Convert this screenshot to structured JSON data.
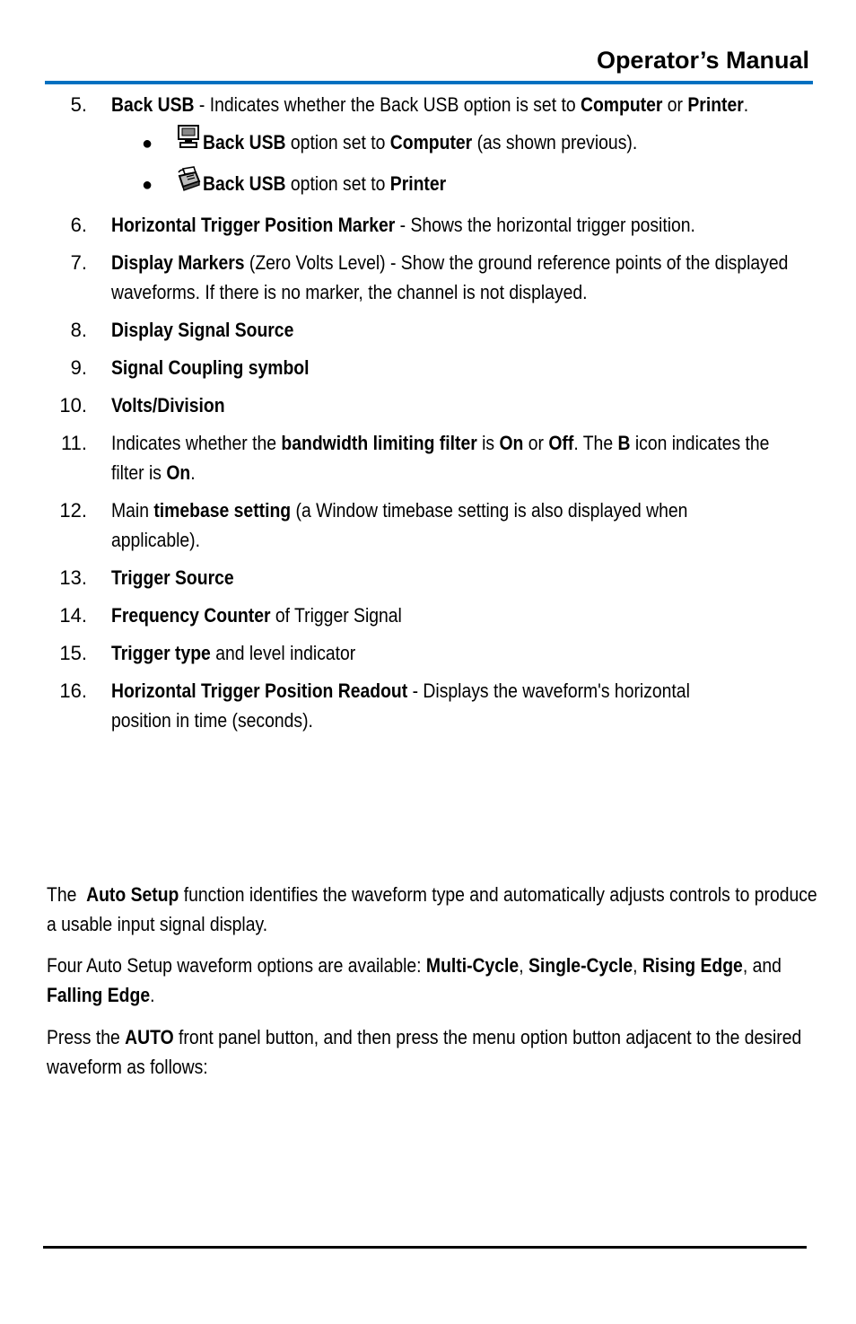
{
  "header": {
    "title": "Operator’s Manual",
    "accent_color": "#0070c0"
  },
  "list": {
    "item5": {
      "num": "5.",
      "b1": "Back USB",
      "t1": " - Indicates whether the Back USB option is set to ",
      "b2": "Computer",
      "t2": " or ",
      "b3": "Printer",
      "t3": ".",
      "bullets": [
        {
          "icon": "computer-icon",
          "b1": "Back USB",
          "t1": " option set to ",
          "b2": "Computer",
          "t2": " (as shown previous)."
        },
        {
          "icon": "printer-icon",
          "b1": "Back USB",
          "t1": " option set to ",
          "b2": "Printer",
          "t2": ""
        }
      ]
    },
    "item6": {
      "num": "6.",
      "b1": "Horizontal Trigger Position Marker",
      "t1": " - Shows the horizontal trigger position."
    },
    "item7": {
      "num": "7.",
      "b1": "Display Markers",
      "t1": " (Zero Volts Level) - Show the ground reference points of the displayed waveforms. If there is no marker, the channel is not displayed."
    },
    "item8": {
      "num": "8.",
      "b1": "Display Signal Source"
    },
    "item9": {
      "num": "9.",
      "b1": "Signal Coupling symbol"
    },
    "item10": {
      "num": "10.",
      "b1": "Volts/Division"
    },
    "item11": {
      "num": "11.",
      "t1": "Indicates whether the ",
      "b1": "bandwidth limiting filter",
      "t2": " is ",
      "b2": "On",
      "t3": " or ",
      "b3": "Off",
      "t4": ". The ",
      "b4": "B",
      "t5": " icon indicates the filter is ",
      "b5": "On",
      "t6": "."
    },
    "item12": {
      "num": "12.",
      "t1": "Main ",
      "b1": "timebase setting",
      "t2": " (a Window timebase setting is also displayed when applicable)."
    },
    "item13": {
      "num": "13.",
      "b1": "Trigger Source"
    },
    "item14": {
      "num": "14.",
      "b1": "Frequency Counter",
      "t1": " of Trigger Signal"
    },
    "item15": {
      "num": "15.",
      "b1": "Trigger type",
      "t1": " and level indicator"
    },
    "item16": {
      "num": "16.",
      "b1": "Horizontal Trigger Position Readout",
      "t1": " - Displays the waveform's horizontal position in time (seconds)."
    }
  },
  "paragraphs": {
    "p1": {
      "t1": "The  ",
      "b1": "Auto Setup",
      "t2": " function identifies the waveform type and automatically adjusts controls to produce a usable input signal display."
    },
    "p2": {
      "t1": "Four Auto Setup waveform options are available: ",
      "b1": "Multi-Cycle",
      "t2": ", ",
      "b2": "Single-Cycle",
      "t3": ", ",
      "b3": "Rising Edge",
      "t4": ", and ",
      "b4": "Falling Edge",
      "t5": "."
    },
    "p3": {
      "t1": "Press the ",
      "b1": "AUTO",
      "t2": " front panel button, and then press the menu option button adjacent to the desired waveform as follows:"
    }
  }
}
